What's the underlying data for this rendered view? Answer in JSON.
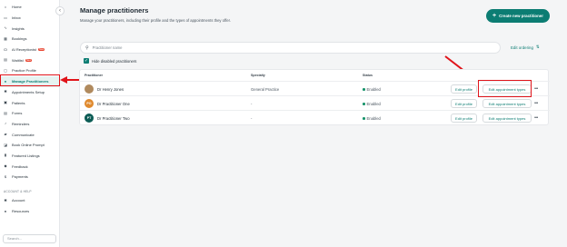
{
  "sidebar": {
    "items": [
      {
        "label": "Home",
        "icon": "home-icon",
        "glyph": "⌂"
      },
      {
        "label": "Inbox",
        "icon": "inbox-icon",
        "glyph": "▭"
      },
      {
        "label": "Insights",
        "icon": "insights-icon",
        "glyph": "∿"
      },
      {
        "label": "Bookings",
        "icon": "calendar-icon",
        "glyph": "▦"
      },
      {
        "label": "AI Receptionist",
        "icon": "headset-icon",
        "glyph": "☊",
        "badge": "New"
      },
      {
        "label": "Waitlist",
        "icon": "waitlist-icon",
        "glyph": "▤",
        "badge": "New"
      },
      {
        "label": "Practice Profile",
        "icon": "profile-icon",
        "glyph": "▢"
      },
      {
        "label": "Manage Practitioners",
        "icon": "user-icon",
        "glyph": "●"
      },
      {
        "label": "Appointments Setup",
        "icon": "gear-icon",
        "glyph": "✱"
      },
      {
        "label": "Patients",
        "icon": "patients-icon",
        "glyph": "▣"
      },
      {
        "label": "Forms",
        "icon": "forms-icon",
        "glyph": "▤"
      },
      {
        "label": "Reminders",
        "icon": "bell-icon",
        "glyph": "♪"
      },
      {
        "label": "Communicate",
        "icon": "chat-icon",
        "glyph": "▰"
      },
      {
        "label": "Book Online Prompt",
        "icon": "book-online-icon",
        "glyph": "◪"
      },
      {
        "label": "Featured Listings",
        "icon": "featured-icon",
        "glyph": "▮"
      },
      {
        "label": "Feedback",
        "icon": "feedback-icon",
        "glyph": "◆"
      },
      {
        "label": "Payments",
        "icon": "payments-icon",
        "glyph": "$"
      }
    ],
    "section_label": "ACCOUNT & HELP",
    "account_items": [
      {
        "label": "Account",
        "icon": "account-gear-icon",
        "glyph": "✱"
      },
      {
        "label": "Resources",
        "icon": "lightbulb-icon",
        "glyph": "●"
      }
    ],
    "search_placeholder": "Search...",
    "collapse_glyph": "‹"
  },
  "header": {
    "title": "Manage practitioners",
    "subtitle": "Manage your practitioners, including their profile and the types of appointments they offer.",
    "create_button": "Create new practitioner"
  },
  "toolbar": {
    "search_placeholder": "Practitioner name",
    "edit_ordering": "Edit ordering",
    "hide_disabled_label": "Hide disabled practitioners",
    "hide_disabled_checked": true
  },
  "table": {
    "columns": [
      "Practitioner",
      "Specialty",
      "Status"
    ],
    "rows": [
      {
        "name": "Dr Henry Jones",
        "initials": "",
        "avatar_color": "#b08a5e",
        "specialty": "General Practice",
        "status": "Enabled"
      },
      {
        "name": "Dr Practitioner One",
        "initials": "PO",
        "avatar_color": "#e08a2e",
        "specialty": "-",
        "status": "Enabled"
      },
      {
        "name": "Dr Practitioner Two",
        "initials": "PT",
        "avatar_color": "#0c5c55",
        "specialty": "-",
        "status": "Enabled"
      }
    ],
    "edit_profile_label": "Edit profile",
    "edit_types_label": "Edit appointment types",
    "more_glyph": "•••"
  },
  "colors": {
    "accent": "#0c7d73",
    "annotation": "#e0141a",
    "status_enabled": "#17936a"
  }
}
